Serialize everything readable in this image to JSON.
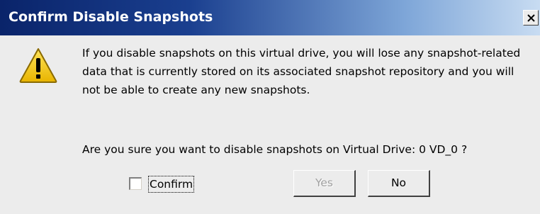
{
  "dialog": {
    "title": "Confirm Disable Snapshots",
    "close_icon": "close-icon",
    "warning_icon": "warning-icon",
    "message": "If you disable snapshots on this virtual drive, you will lose any snapshot-related data that is currently stored on its associated snapshot repository and you will not be able to create any new snapshots.",
    "question": "Are you sure you want to disable snapshots on Virtual Drive: 0 VD_0 ?",
    "confirm_label": "Confirm",
    "confirm_checked": false,
    "yes_label": "Yes",
    "yes_enabled": false,
    "no_label": "No"
  },
  "colors": {
    "titlebar_start": "#0a246a",
    "titlebar_end": "#c8dcf2",
    "dialog_background": "#ececec",
    "warning_fill": "#f5c800"
  }
}
